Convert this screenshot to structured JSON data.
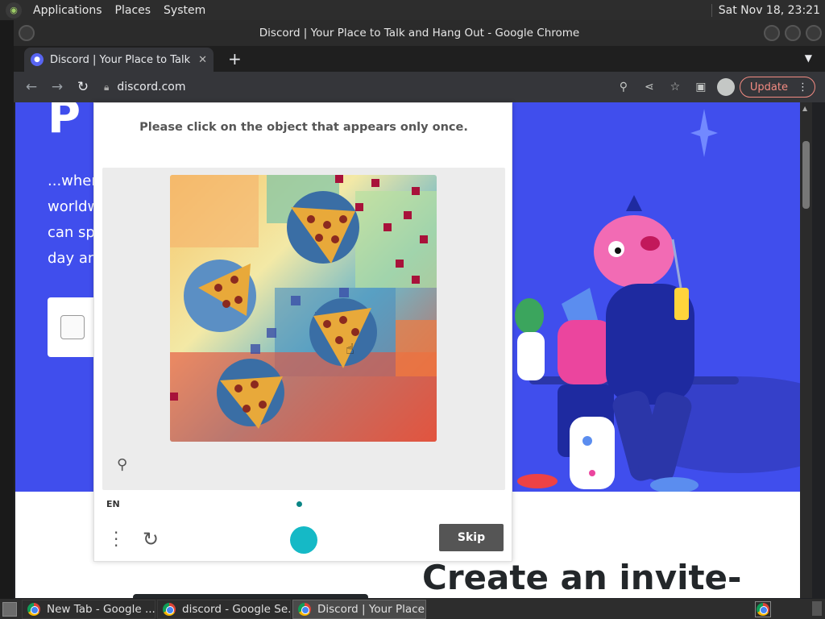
{
  "top_panel": {
    "menus": [
      "Applications",
      "Places",
      "System"
    ],
    "clock": "Sat Nov 18, 23:21"
  },
  "window": {
    "title": "Discord | Your Place to Talk and Hang Out - Google Chrome"
  },
  "tab": {
    "title": "Discord | Your Place to Talk and Hang Out",
    "close": "✕",
    "new_tab": "+"
  },
  "toolbar": {
    "url": "discord.com",
    "update_label": "Update"
  },
  "page": {
    "hero_heading": "P",
    "hero_lines": [
      "...wher",
      "worldw",
      "can sp",
      "day an"
    ],
    "bottom_heading": "Create an invite-"
  },
  "captcha": {
    "prompt": "Please click on the object that appears only once.",
    "language": "EN",
    "skip_label": "Skip"
  },
  "taskbar": {
    "tasks": [
      {
        "label": "New Tab - Google ...",
        "active": false
      },
      {
        "label": "discord - Google Se...",
        "active": false
      },
      {
        "label": "Discord | Your Place ...",
        "active": true
      }
    ]
  },
  "colors": {
    "discord_blurple": "#404eed",
    "hcaptcha_teal": "#15b9c6",
    "update_accent": "#f28b82"
  }
}
